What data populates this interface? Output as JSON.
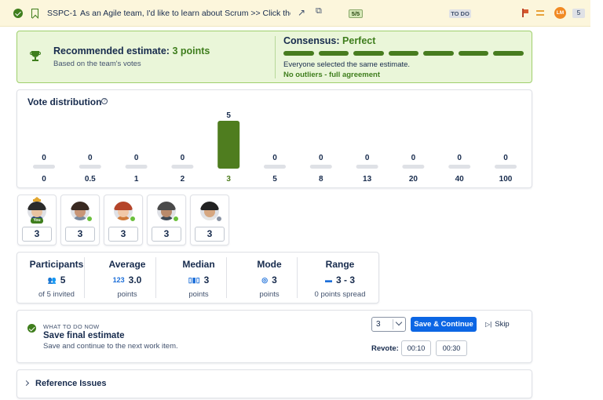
{
  "issue": {
    "key": "SSPC-1",
    "title": "As an Agile team, I'd like to learn about Scrum >> Click the \"SS...",
    "votes_badge": "5/5",
    "status": "TO DO",
    "assignee_initials": "LM",
    "story_points": "5",
    "icons": [
      "check-circle-icon",
      "story-bookmark-icon",
      "external-link-icon",
      "copy-icon",
      "flag-icon",
      "priority-medium-icon"
    ]
  },
  "recommendation": {
    "title_prefix": "Recommended estimate:",
    "value": "3 points",
    "subtitle": "Based on the team's votes",
    "icon": "trophy-icon"
  },
  "consensus": {
    "title_prefix": "Consensus:",
    "value": "Perfect",
    "segments_filled": 7,
    "segments_total": 7,
    "line1": "Everyone selected the same estimate.",
    "line2": "No outliers - full agreement",
    "color": "#477c1f"
  },
  "distribution": {
    "title": "Vote distribution",
    "help_icon": "?"
  },
  "chart_data": {
    "type": "bar",
    "categories": [
      "0",
      "0.5",
      "1",
      "2",
      "3",
      "5",
      "8",
      "13",
      "20",
      "40",
      "100"
    ],
    "values": [
      0,
      0,
      0,
      0,
      5,
      0,
      0,
      0,
      0,
      0,
      0
    ],
    "value_labels": [
      "0",
      "0",
      "0",
      "0",
      "5",
      "0",
      "0",
      "0",
      "0",
      "0",
      "0"
    ],
    "ylim": [
      0,
      5
    ],
    "highlight_category": "3",
    "bar_color": "#4f7d1f",
    "empty_color": "#dfe1e6",
    "grid": false
  },
  "participants": [
    {
      "vote": "3",
      "is_you": true,
      "you_label": "You",
      "crown": true,
      "status_color": "#3f7e1d",
      "hair": "#2b2b2b",
      "skin": "#e9c3a1",
      "shirt": "#2b4a7a"
    },
    {
      "vote": "3",
      "is_you": false,
      "status_color": "#6abf3c",
      "hair": "#3a2a22",
      "skin": "#c89577",
      "shirt": "#7a8aa0"
    },
    {
      "vote": "3",
      "is_you": false,
      "status_color": "#6abf3c",
      "hair": "#b5452a",
      "skin": "#f1c8a8",
      "shirt": "#d07a3a"
    },
    {
      "vote": "3",
      "is_you": false,
      "status_color": "#6abf3c",
      "hair": "#4a4a4a",
      "skin": "#b98a6b",
      "shirt": "#3e4a56"
    },
    {
      "vote": "3",
      "is_you": false,
      "status_color": "#8993a4",
      "hair": "#222222",
      "skin": "#d6a781",
      "shirt": "#e5e5e5"
    }
  ],
  "stats": [
    {
      "label": "Participants",
      "icon": "participants-icon",
      "glyph": "👥",
      "value": "5",
      "sub": "of 5 invited"
    },
    {
      "label": "Average",
      "icon": "average-icon",
      "glyph": "123",
      "value": "3.0",
      "sub": "points"
    },
    {
      "label": "Median",
      "icon": "median-icon",
      "glyph": "▯▮▯",
      "value": "3",
      "sub": "points"
    },
    {
      "label": "Mode",
      "icon": "mode-icon",
      "glyph": "◎",
      "value": "3",
      "sub": "points"
    },
    {
      "label": "Range",
      "icon": "range-icon",
      "glyph": "▬",
      "value": "3 - 3",
      "sub": "0 points spread"
    }
  ],
  "next_step": {
    "eyebrow": "WHAT TO DO NOW",
    "title": "Save final estimate",
    "subtitle": "Save and continue to the next work item.",
    "select_value": "3",
    "save_label": "Save & Continue",
    "skip_label": "Skip",
    "revote_label": "Revote:",
    "revote_options": [
      "00:10",
      "00:30"
    ]
  },
  "reference": {
    "title": "Reference Issues"
  }
}
